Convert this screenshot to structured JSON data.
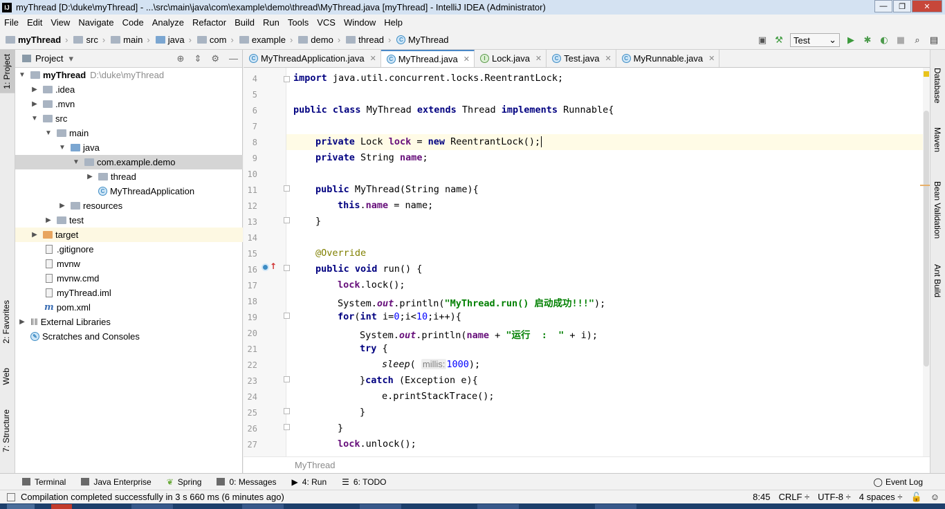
{
  "title": "myThread [D:\\duke\\myThread] - ...\\src\\main\\java\\com\\example\\demo\\thread\\MyThread.java [myThread] - IntelliJ IDEA (Administrator)",
  "window_buttons": {
    "min": "—",
    "max": "❐",
    "close": "✕"
  },
  "menu": [
    "File",
    "Edit",
    "View",
    "Navigate",
    "Code",
    "Analyze",
    "Refactor",
    "Build",
    "Run",
    "Tools",
    "VCS",
    "Window",
    "Help"
  ],
  "breadcrumbs": [
    "myThread",
    "src",
    "main",
    "java",
    "com",
    "example",
    "demo",
    "thread",
    "MyThread"
  ],
  "run_config": "Test",
  "left_tabs": {
    "project": "1: Project",
    "favorites": "2: Favorites",
    "web": "Web",
    "structure": "7: Structure"
  },
  "right_tabs": {
    "database": "Database",
    "maven": "Maven",
    "bean": "Bean Validation",
    "ant": "Ant Build"
  },
  "project": {
    "header": "Project",
    "tree": [
      {
        "label": "myThread",
        "extra": "D:\\duke\\myThread"
      },
      {
        "label": ".idea"
      },
      {
        "label": ".mvn"
      },
      {
        "label": "src"
      },
      {
        "label": "main"
      },
      {
        "label": "java"
      },
      {
        "label": "com.example.demo"
      },
      {
        "label": "thread"
      },
      {
        "label": "MyThreadApplication"
      },
      {
        "label": "resources"
      },
      {
        "label": "test"
      },
      {
        "label": "target"
      },
      {
        "label": ".gitignore"
      },
      {
        "label": "mvnw"
      },
      {
        "label": "mvnw.cmd"
      },
      {
        "label": "myThread.iml"
      },
      {
        "label": "pom.xml"
      },
      {
        "label": "External Libraries"
      },
      {
        "label": "Scratches and Consoles"
      }
    ]
  },
  "tabs": [
    "MyThreadApplication.java",
    "MyThread.java",
    "Lock.java",
    "Test.java",
    "MyRunnable.java"
  ],
  "editor": {
    "line_numbers": [
      "4",
      "5",
      "6",
      "7",
      "8",
      "9",
      "10",
      "11",
      "12",
      "13",
      "14",
      "15",
      "16",
      "17",
      "18",
      "19",
      "20",
      "21",
      "22",
      "23",
      "24",
      "25",
      "26",
      "27"
    ],
    "code": {
      "l4_kw": "import",
      "l4_rest": " java.util.concurrent.locks.ReentrantLock;",
      "l6_kw1": "public class",
      "l6_name": " MyThread ",
      "l6_kw2": "extends",
      "l6_mid": " Thread ",
      "l6_kw3": "implements",
      "l6_rest": " Runnable{",
      "l8_kw1": "private",
      "l8_type": " Lock ",
      "l8_field": "lock",
      "l8_eq": " = ",
      "l8_kw2": "new",
      "l8_rest": " ReentrantLock();",
      "l9_kw": "private",
      "l9_type": " String ",
      "l9_field": "name",
      "l9_rest": ";",
      "l11_kw": "public",
      "l11_rest": " MyThread(String name){",
      "l12_kw": "this",
      "l12_dot": ".",
      "l12_field": "name",
      "l12_rest": " = name;",
      "l13": "}",
      "l15_ann": "@Override",
      "l16_kw": "public void",
      "l16_rest": " run() {",
      "l17_field": "lock",
      "l17_rest": ".lock();",
      "l18_pre": "System.",
      "l18_out": "out",
      "l18_mid": ".println(",
      "l18_str": "\"MyThread.run() 启动成功!!!\"",
      "l18_rest": ");",
      "l19_kw1": "for",
      "l19_p1": "(",
      "l19_kw2": "int",
      "l19_p2": " i=",
      "l19_n1": "0",
      "l19_p3": ";i<",
      "l19_n2": "10",
      "l19_p4": ";i++){",
      "l20_pre": "System.",
      "l20_out": "out",
      "l20_mid": ".println(",
      "l20_field": "name",
      "l20_plus": " + ",
      "l20_str": "\"运行  :  \"",
      "l20_rest": " + i);",
      "l21_kw": "try",
      "l21_rest": " {",
      "l22_fn": "sleep",
      "l22_p": "( ",
      "l22_hint": "millis:",
      "l22_num": "1000",
      "l22_rest": ");",
      "l23_pre": "}",
      "l23_kw": "catch",
      "l23_rest": " (Exception e){",
      "l24": "e.printStackTrace();",
      "l25": "}",
      "l26": "}",
      "l27_field": "lock",
      "l27_rest": ".unlock();"
    }
  },
  "editor_breadcrumb": "MyThread",
  "toolwindows": [
    "Terminal",
    "Java Enterprise",
    "Spring",
    "0: Messages",
    "4: Run",
    "6: TODO"
  ],
  "event_log": "Event Log",
  "status": {
    "message": "Compilation completed successfully in 3 s 660 ms (6 minutes ago)",
    "position": "8:45",
    "line_sep": "CRLF ÷",
    "encoding": "UTF-8 ÷",
    "indent": "4 spaces ÷"
  },
  "colors": {
    "keyword": "#000080",
    "field": "#660e7a",
    "string": "#008000",
    "number": "#0000ff",
    "annotation": "#808000",
    "accent": "#4a88c7"
  }
}
